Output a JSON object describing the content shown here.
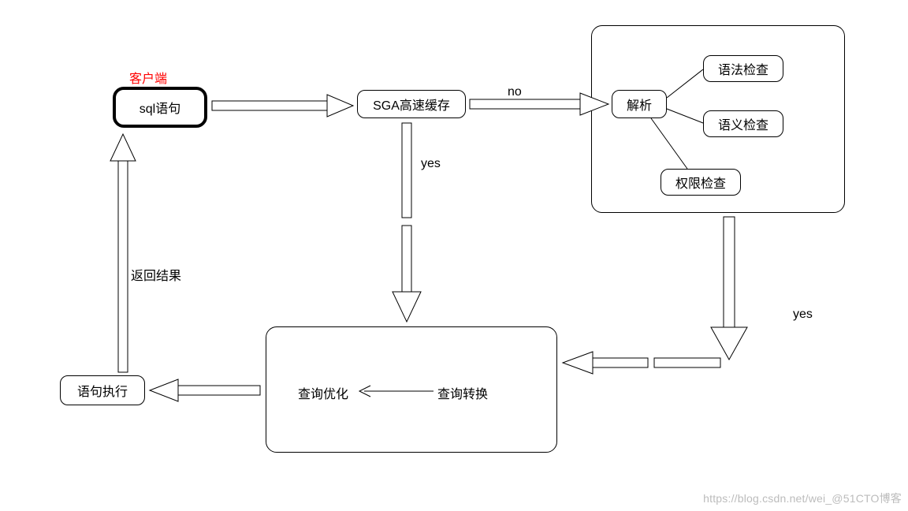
{
  "labels": {
    "client": "客户端",
    "sql": "sql语句",
    "sga": "SGA高速缓存",
    "no": "no",
    "yes1": "yes",
    "yes2": "yes",
    "parse": "解析",
    "syntax": "语法检查",
    "semantic": "语义检查",
    "permission": "权限检查",
    "query_optimize": "查询优化",
    "query_transform": "查询转换",
    "exec": "语句执行",
    "return_result": "返回结果"
  },
  "watermark": "https://blog.csdn.net/wei_@51CTO博客"
}
